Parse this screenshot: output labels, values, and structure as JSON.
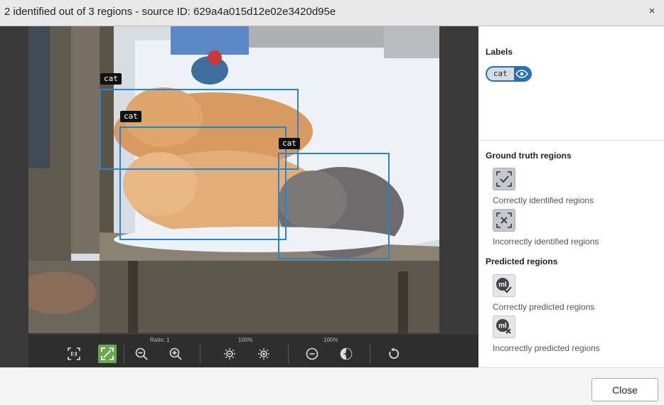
{
  "window": {
    "title": "2 identified out of 3 regions - source ID: 629a4a015d12e02e3420d95e",
    "close_glyph": "×"
  },
  "image": {
    "subject": "three cats on a snowy wooden table",
    "regions": [
      {
        "label": "cat"
      },
      {
        "label": "cat"
      },
      {
        "label": "cat"
      }
    ],
    "region_color": "#2b84c5"
  },
  "toolbar": {
    "ratio_caption": "Ratio: 1",
    "brightness_caption": "100%",
    "contrast_caption": "100%",
    "buttons": [
      {
        "icon": "actual-size-icon"
      },
      {
        "icon": "fit-to-screen-icon",
        "active": true
      },
      {
        "icon": "zoom-out-icon"
      },
      {
        "icon": "zoom-in-icon"
      },
      {
        "icon": "brightness-down-icon"
      },
      {
        "icon": "brightness-up-icon"
      },
      {
        "icon": "contrast-down-icon"
      },
      {
        "icon": "contrast-up-icon"
      },
      {
        "icon": "reset-icon"
      }
    ],
    "active_color": "#6aa84f"
  },
  "sidebar": {
    "labels_heading": "Labels",
    "labels": [
      {
        "text": "cat",
        "visible": true
      }
    ],
    "ground_truth_heading": "Ground truth regions",
    "ground_truth": [
      {
        "icon": "correct-region-icon",
        "text": "Correctly identified regions"
      },
      {
        "icon": "incorrect-region-icon",
        "text": "Incorrectly identified regions"
      }
    ],
    "predicted_heading": "Predicted regions",
    "predicted": [
      {
        "icon": "ml-correct-icon",
        "text": "Correctly predicted regions"
      },
      {
        "icon": "ml-incorrect-icon",
        "text": "Incorrectly predicted regions"
      }
    ]
  },
  "footer": {
    "close_label": "Close"
  }
}
